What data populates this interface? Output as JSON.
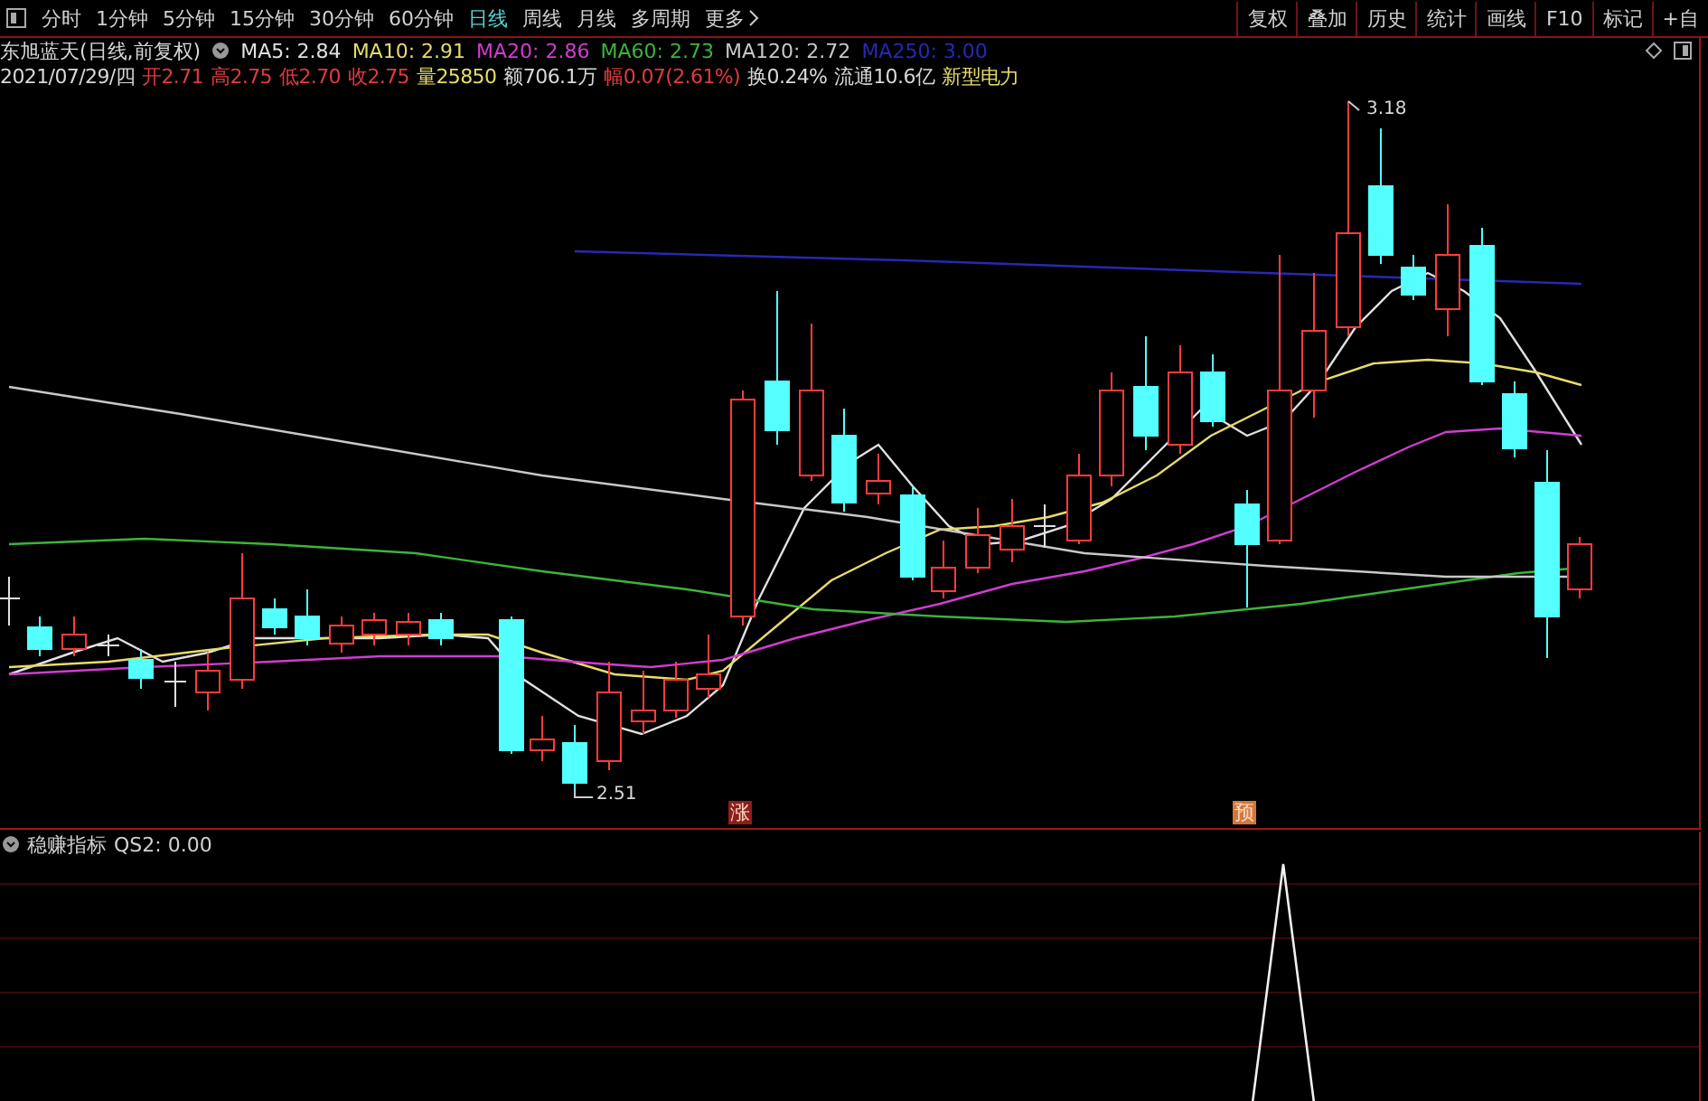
{
  "toolbar": {
    "periods": [
      {
        "label": "分时",
        "selected": false
      },
      {
        "label": "1分钟",
        "selected": false
      },
      {
        "label": "5分钟",
        "selected": false
      },
      {
        "label": "15分钟",
        "selected": false
      },
      {
        "label": "30分钟",
        "selected": false
      },
      {
        "label": "60分钟",
        "selected": false
      },
      {
        "label": "日线",
        "selected": true
      },
      {
        "label": "周线",
        "selected": false
      },
      {
        "label": "月线",
        "selected": false
      },
      {
        "label": "多周期",
        "selected": false
      },
      {
        "label": "更多",
        "selected": false
      }
    ],
    "buttons": [
      "复权",
      "叠加",
      "历史",
      "统计",
      "画线",
      "F10",
      "标记",
      "+自"
    ]
  },
  "chart": {
    "title": "东旭蓝天(日线,前复权)",
    "ma_legend": [
      {
        "label": "MA5: 2.84",
        "color": "#e0e0e0"
      },
      {
        "label": "MA10: 2.91",
        "color": "#e6dc6a"
      },
      {
        "label": "MA20: 2.86",
        "color": "#d23cd2"
      },
      {
        "label": "MA60: 2.73",
        "color": "#3cb43c"
      },
      {
        "label": "MA120: 2.72",
        "color": "#c8c8c8"
      },
      {
        "label": "MA250: 3.00",
        "color": "#2828b4"
      }
    ],
    "quote": [
      {
        "text": "2021/07/29/四",
        "color": "#d8d8d8"
      },
      {
        "text": "开2.71",
        "color": "#e03c3c"
      },
      {
        "text": "高2.75",
        "color": "#e03c3c"
      },
      {
        "text": "低2.70",
        "color": "#e03c3c"
      },
      {
        "text": "收2.75",
        "color": "#e03c3c"
      },
      {
        "text": "量25850",
        "color": "#e6dc6a"
      },
      {
        "text": "额706.1万",
        "color": "#d8d8d8"
      },
      {
        "text": "幅0.07(2.61%)",
        "color": "#e03c3c"
      },
      {
        "text": "换0.24%",
        "color": "#d8d8d8"
      },
      {
        "text": "流通10.6亿",
        "color": "#d8d8d8"
      },
      {
        "text": "新型电力",
        "color": "#e6dc6a"
      }
    ],
    "high_label": "3.18",
    "low_label": "2.51",
    "signals": [
      {
        "label": "涨",
        "color": "#8c1e1e"
      },
      {
        "label": "预",
        "color": "#d2783c"
      }
    ]
  },
  "indicator": {
    "title": "稳赚指标",
    "reading": "QS2: 0.00"
  }
}
